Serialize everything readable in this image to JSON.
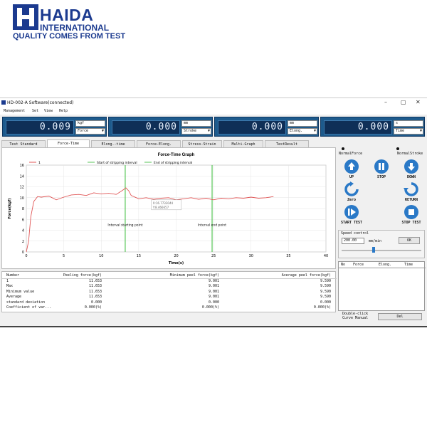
{
  "brand": {
    "name": "HAIDA",
    "subtitle": "INTERNATIONAL",
    "tagline": "QUALITY COMES FROM TEST",
    "color": "#1b3a8f"
  },
  "window": {
    "title": "HD-002-A Software(connected)",
    "controls": [
      "–",
      "▢",
      "✕"
    ]
  },
  "menu": [
    "Management",
    "Set",
    "View",
    "Help"
  ],
  "meters": [
    {
      "value": "0.009",
      "unit": "kgf",
      "select": "Force"
    },
    {
      "value": "0.000",
      "unit": "mm",
      "select": "Stroke"
    },
    {
      "value": "0.000",
      "unit": "mm",
      "select": "Elong."
    },
    {
      "value": "0.000",
      "unit": "s",
      "select": "Time"
    }
  ],
  "tabs": [
    "Test Standard",
    "Force-Time",
    "Elong.-time",
    "Force-Elong.",
    "Stress-Strain",
    "Multi-Graph",
    "TestResult"
  ],
  "active_tab": "Force-Time",
  "chart_data": {
    "type": "line",
    "title": "Force-Time Graph",
    "xlabel": "Time(s)",
    "ylabel": "Force(kgf)",
    "xlim": [
      0,
      40
    ],
    "ylim": [
      0,
      16
    ],
    "xticks": [
      "0",
      "5",
      "10",
      "15",
      "20",
      "25",
      "30",
      "35",
      "40"
    ],
    "yticks": [
      "0",
      "2",
      "4",
      "6",
      "8",
      "10",
      "12",
      "14",
      "16"
    ],
    "legend": [
      "1",
      "Start of stripping interval",
      "End of stripping interval"
    ],
    "grid": true,
    "series": [
      {
        "name": "1",
        "color": "#e05555",
        "x": [
          0,
          0.3,
          0.6,
          1.0,
          1.5,
          2.0,
          3,
          4,
          5,
          6,
          7,
          8,
          9,
          10,
          11,
          12,
          12.8,
          13.3,
          13.7,
          14,
          15,
          16,
          17,
          18,
          19,
          20,
          21,
          22,
          23,
          24,
          25,
          26,
          27,
          28,
          29,
          30,
          31,
          32,
          33
        ],
        "y": [
          0,
          2.0,
          6.5,
          9.3,
          10.2,
          10.1,
          10.3,
          9.6,
          10.1,
          10.5,
          10.6,
          10.4,
          10.9,
          10.7,
          10.8,
          10.6,
          11.3,
          11.8,
          11.2,
          10.4,
          9.8,
          10.0,
          9.7,
          9.9,
          10.0,
          9.6,
          9.8,
          10.0,
          9.7,
          9.9,
          9.6,
          9.9,
          9.8,
          10.0,
          9.9,
          10.1,
          9.9,
          10.0,
          10.2
        ]
      }
    ],
    "interval_start_x": 13.2,
    "interval_end_x": 24.8,
    "annotations": [
      "Interval starting point",
      "Interval end point"
    ],
    "tooltip": [
      "X:16.7733044",
      "Y:8.466657"
    ]
  },
  "results": {
    "headers": [
      "Number",
      "Peeling force(kgf)",
      "Minimum peel force(kgf)",
      "Average peel force(kgf)"
    ],
    "rows": [
      [
        "1",
        "11.653",
        "9.001",
        "9.590"
      ],
      [
        "Max",
        "11.653",
        "9.001",
        "9.590"
      ],
      [
        "Minimum value",
        "11.653",
        "9.001",
        "9.590"
      ],
      [
        "Average",
        "11.653",
        "9.001",
        "9.590"
      ],
      [
        "standard deviation",
        "0.000",
        "0.000",
        "0.000"
      ],
      [
        "Coefficient of var...",
        "0.000(%)",
        "0.000(%)",
        "0.000(%)"
      ]
    ]
  },
  "side": {
    "mode_left": "NormalForce",
    "mode_right": "NormalStroke",
    "buttons": [
      "UP",
      "STOP",
      "DOWN",
      "Zero",
      "RETURN",
      "START TEST",
      "STOP TEST"
    ],
    "speed_label": "Speed control",
    "speed_value": "200.00",
    "speed_unit": "mm/min",
    "ok_label": "OK",
    "table_headers": [
      "No",
      "Force",
      "Elong.",
      "Time"
    ],
    "hint_line1": "Double-click",
    "hint_line2": "Curve Manual",
    "del_label": "Del",
    "accent": "#2a79c7"
  }
}
